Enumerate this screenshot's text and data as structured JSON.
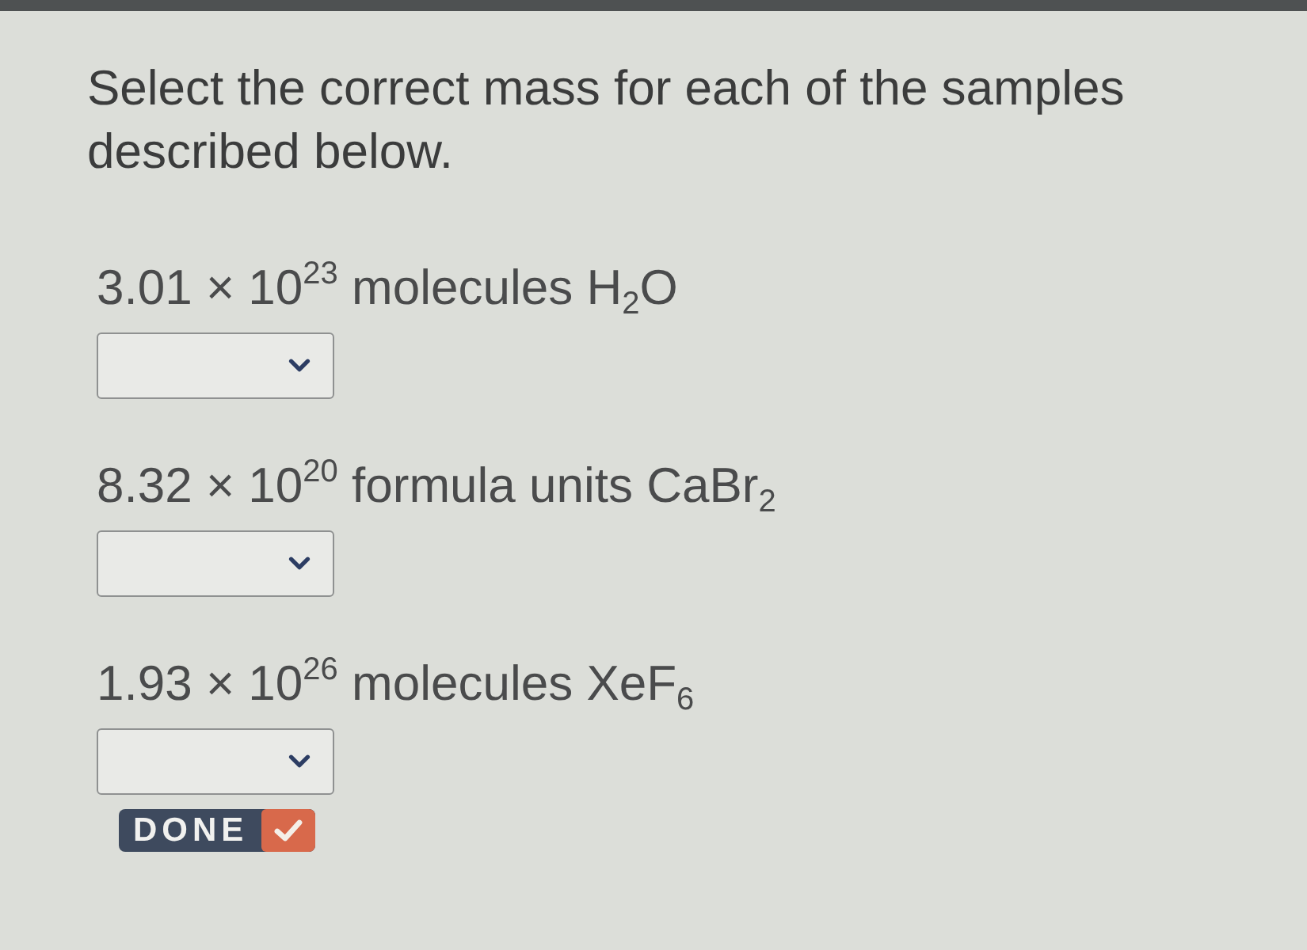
{
  "prompt": "Select the correct mass for each of the samples described below.",
  "samples": [
    {
      "quantity": "3.01 × 10$^{23}$ molecules H$_{2}$O"
    },
    {
      "quantity": "8.32 × 10$^{20}$ formula units CaBr$_{2}$"
    },
    {
      "quantity": "1.93 × 10$^{26}$ molecules XeF$_{6}$"
    }
  ],
  "done_button": {
    "label": "DONE"
  }
}
